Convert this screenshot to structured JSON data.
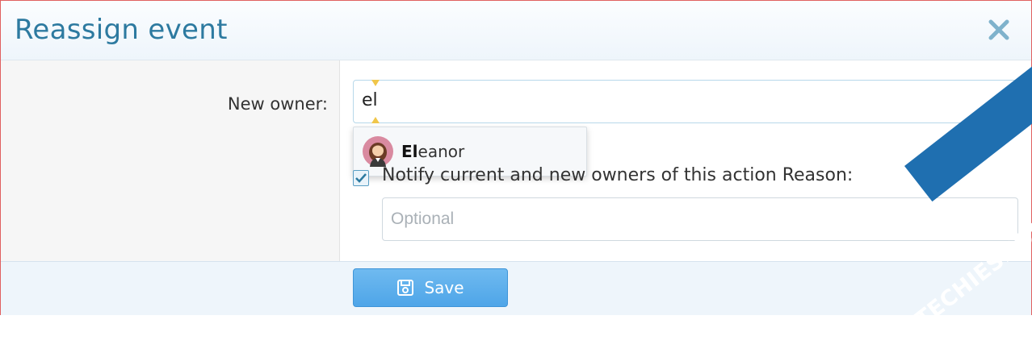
{
  "dialog": {
    "title": "Reassign event",
    "close_icon": "close-icon"
  },
  "owner": {
    "label": "New owner:",
    "value": "el",
    "suggestion": {
      "match": "El",
      "rest": "eanor",
      "avatar_icon": "user-avatar-icon"
    }
  },
  "notify": {
    "checked": true,
    "label": "Notify current and new owners of this action Reason:"
  },
  "reason": {
    "placeholder": "Optional"
  },
  "footer": {
    "save_label": "Save",
    "save_icon": "floppy-disk-icon"
  },
  "watermark": {
    "text": "TECHIESHOME.COM"
  },
  "colors": {
    "title": "#2d7aa0",
    "save_button": "#4ea5e8",
    "watermark_band": "#1f6fb0"
  }
}
